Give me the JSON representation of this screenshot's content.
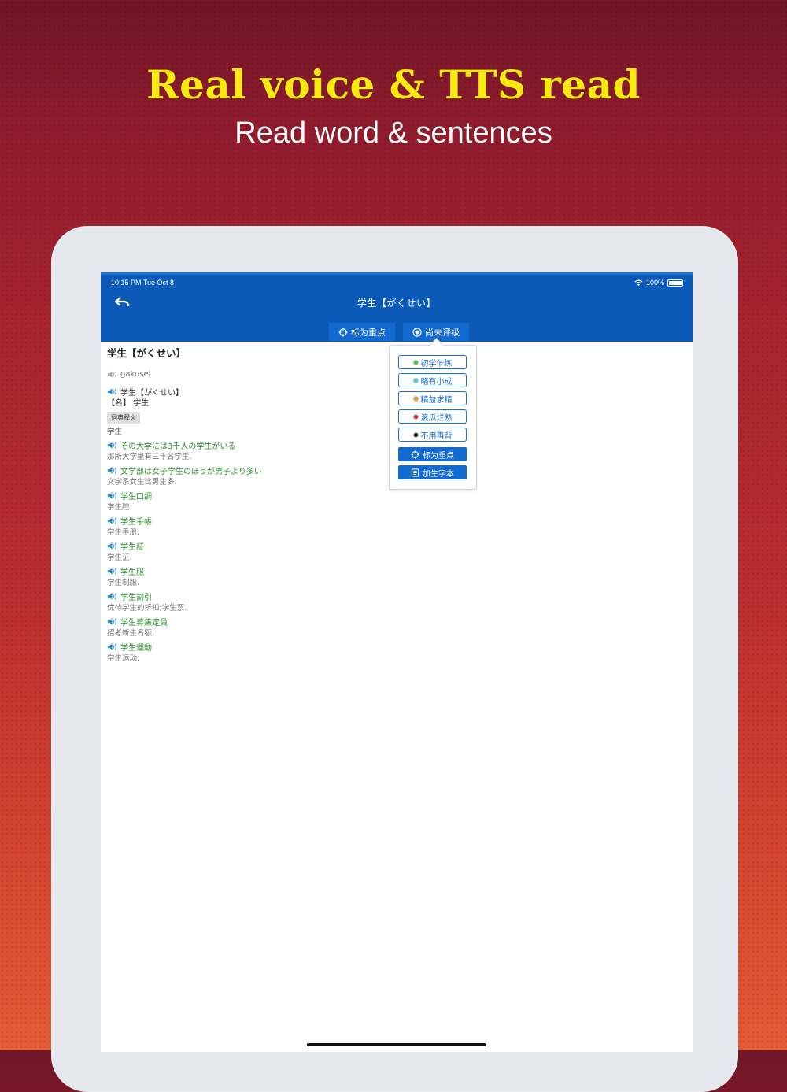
{
  "marketing": {
    "headline": "Real voice & TTS read",
    "subline": "Read word & sentences"
  },
  "status": {
    "time": "10:15 PM   Tue Oct 8",
    "battery": "100%"
  },
  "nav": {
    "title": "学生【がくせい】"
  },
  "tabs": [
    {
      "label": "标为重点",
      "icon": "crosshair-icon"
    },
    {
      "label": "尚未评级",
      "icon": "radio-icon"
    }
  ],
  "entry": {
    "title": "学生【がくせい】",
    "romaji": "gakusei",
    "headword": "学生【がくせい】",
    "pos": "【名】 学生",
    "tag": "词典释义",
    "meaning": "学生"
  },
  "examples": [
    {
      "jp": "その大学には3千人の学生がいる",
      "cn": "那所大学里有三千名学生."
    },
    {
      "jp": "文学部は女子学生のほうが男子より多い",
      "cn": "文学系女生比男生多."
    },
    {
      "jp": "学生口調",
      "cn": "学生腔."
    },
    {
      "jp": "学生手帳",
      "cn": "学生手册."
    },
    {
      "jp": "学生証",
      "cn": "学生证."
    },
    {
      "jp": "学生服",
      "cn": "学生制服."
    },
    {
      "jp": "学生割引",
      "cn": "优待学生的折扣;学生票."
    },
    {
      "jp": "学生募集定員",
      "cn": "招考新生名额."
    },
    {
      "jp": "学生運動",
      "cn": "学生运动."
    }
  ],
  "popup": {
    "levels": [
      {
        "label": "初学乍练",
        "color": "#35d14a"
      },
      {
        "label": "略有小成",
        "color": "#3fd7d7"
      },
      {
        "label": "精益求精",
        "color": "#f29a2e"
      },
      {
        "label": "滚瓜烂熟",
        "color": "#e8262b"
      },
      {
        "label": "不用再背",
        "color": "#111111"
      }
    ],
    "mark_label": "标为重点",
    "add_label": "加生字本"
  },
  "colors": {
    "nav_blue": "#0b5ab8",
    "accent_blue": "#1a6ed6",
    "example_green": "#2e8b2e",
    "headline_yellow": "#f7ea10"
  }
}
